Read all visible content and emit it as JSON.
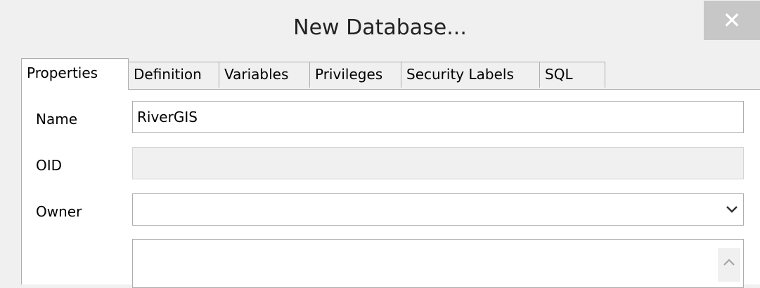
{
  "window": {
    "title": "New Database...",
    "close_label": "✕"
  },
  "tabs": [
    {
      "label": "Properties",
      "active": true
    },
    {
      "label": "Definition",
      "active": false
    },
    {
      "label": "Variables",
      "active": false
    },
    {
      "label": "Privileges",
      "active": false
    },
    {
      "label": "Security Labels",
      "active": false
    },
    {
      "label": "SQL",
      "active": false
    }
  ],
  "form": {
    "name_label": "Name",
    "name_value": "RiverGIS",
    "oid_label": "OID",
    "oid_value": "",
    "owner_label": "Owner",
    "owner_value": "",
    "comment_value": ""
  },
  "icons": {
    "owner_dropdown": "chevron-down-icon",
    "textarea_scroll": "chevron-up-icon"
  }
}
